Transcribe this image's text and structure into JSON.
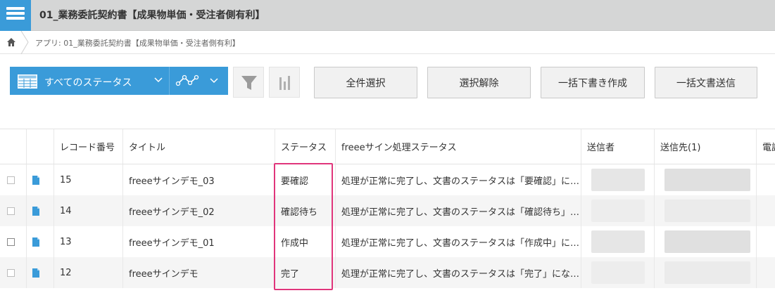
{
  "app": {
    "title": "01_業務委託契約書【成果物単価・受注者側有利】"
  },
  "breadcrumb": {
    "text": "アプリ: 01_業務委託契約書【成果物単価・受注者側有利】"
  },
  "toolbar": {
    "view_label": "すべてのステータス",
    "buttons": [
      "全件選択",
      "選択解除",
      "一括下書き作成",
      "一括文書送信"
    ]
  },
  "table": {
    "columns": [
      "レコード番号",
      "タイトル",
      "ステータス",
      "freeeサイン処理ステータス",
      "送信者",
      "送信先(1)",
      "電話"
    ],
    "rows": [
      {
        "id": "15",
        "title": "freeeサインデモ_03",
        "status": "要確認",
        "freee_status": "処理が正常に完了し、文書のステータスは「要確認」に…"
      },
      {
        "id": "14",
        "title": "freeeサインデモ_02",
        "status": "確認待ち",
        "freee_status": "処理が正常に完了し、文書のステータスは「確認待ち」…"
      },
      {
        "id": "13",
        "title": "freeeサインデモ_01",
        "status": "作成中",
        "freee_status": "処理が正常に完了し、文書のステータスは「作成中」に…"
      },
      {
        "id": "12",
        "title": "freeeサインデモ",
        "status": "完了",
        "freee_status": "処理が正常に完了し、文書のステータスは「完了」にな…"
      }
    ]
  },
  "colors": {
    "accent": "#3a9bd9",
    "highlight": "#e0357b",
    "header_bg": "#d5d6d6"
  }
}
